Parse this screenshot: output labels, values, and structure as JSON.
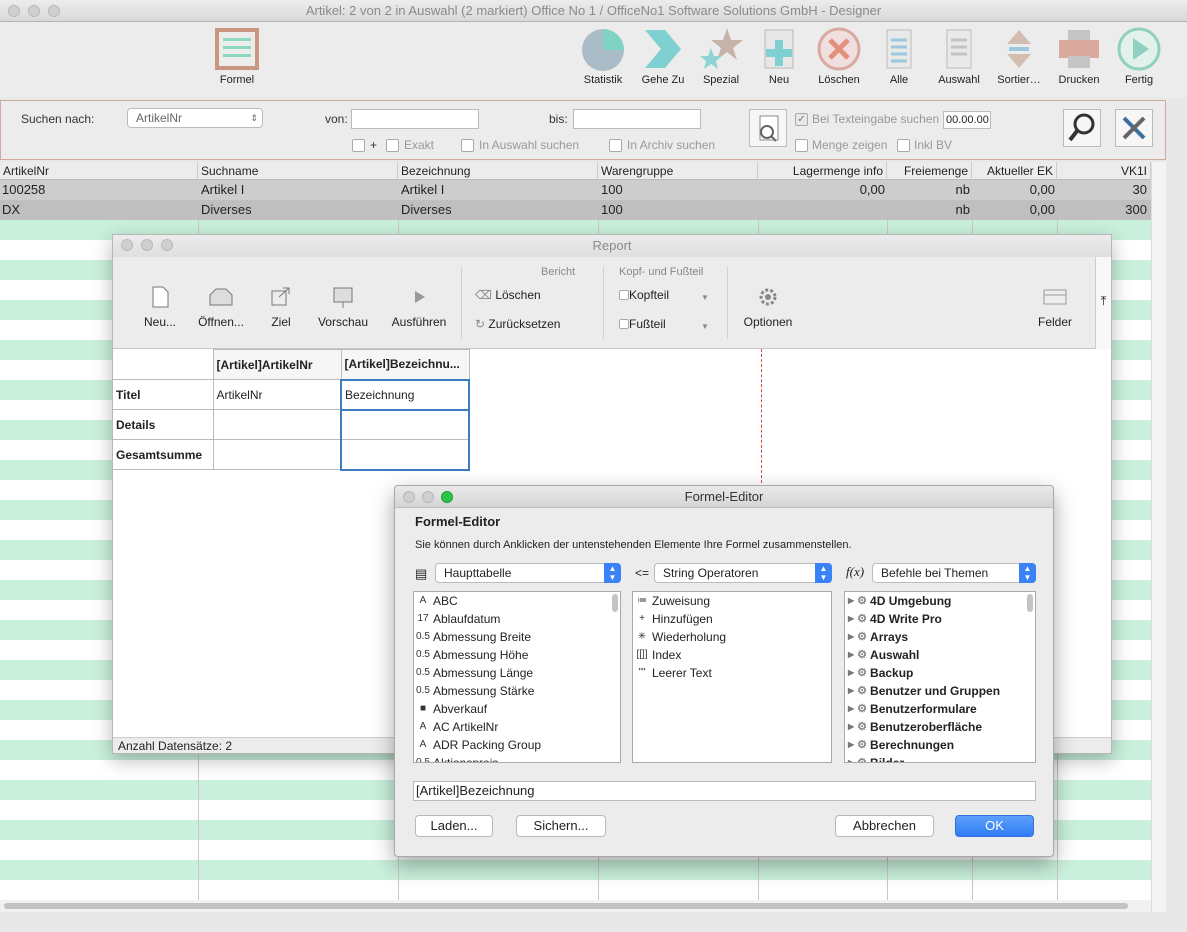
{
  "window": {
    "title": "Artikel: 2 von 2 in Auswahl  (2 markiert) Office No 1 /  OfficeNo1 Software Solutions GmbH - Designer"
  },
  "toolbar": {
    "formel": "Formel",
    "statistik": "Statistik",
    "gehe_zu": "Gehe Zu",
    "spezial": "Spezial",
    "neu": "Neu",
    "loeschen": "Löschen",
    "alle": "Alle",
    "auswahl": "Auswahl",
    "sortier": "Sortier…",
    "drucken": "Drucken",
    "fertig": "Fertig"
  },
  "search": {
    "suchen_nach_label": "Suchen nach:",
    "field_select": "ArtikelNr",
    "von_label": "von:",
    "von_value": "",
    "bis_label": "bis:",
    "bis_value": "",
    "plus": "+",
    "exakt": "Exakt",
    "in_auswahl": "In Auswahl suchen",
    "in_archiv": "In Archiv suchen",
    "bei_texteingabe": "Bei Texteingabe suchen",
    "time_value": "00.00.00",
    "menge_zeigen": "Menge zeigen",
    "inkl_bv": "Inkl BV"
  },
  "table": {
    "headers": [
      "ArtikelNr",
      "Suchname",
      "Bezeichnung",
      "Warengruppe",
      "Lagermenge info",
      "Freiemenge",
      "Aktueller EK",
      "VK1I"
    ],
    "rows": [
      [
        "100258",
        "Artikel I",
        "Artikel I",
        "100",
        "0,00",
        "nb",
        "0,00",
        "30"
      ],
      [
        "DX",
        "Diverses",
        "Diverses",
        "100",
        "",
        "nb",
        "0,00",
        "300"
      ]
    ]
  },
  "report": {
    "title": "Report",
    "section_bericht": "Bericht",
    "section_kopf": "Kopf- und Fußteil",
    "neu": "Neu...",
    "oeffnen": "Öffnen...",
    "ziel": "Ziel",
    "vorschau": "Vorschau",
    "ausfuehren": "Ausführen",
    "loeschen": "Löschen",
    "zuruecksetzen": "Zurücksetzen",
    "kopfteil": "Kopfteil",
    "fussteil": "Fußteil",
    "optionen": "Optionen",
    "felder": "Felder",
    "col1": "[Artikel]ArtikelNr",
    "col2": "[Artikel]Bezeichnu...",
    "row_titel": "Titel",
    "row_details": "Details",
    "row_gesamt": "Gesamtsumme",
    "titel_c1": "ArtikelNr",
    "titel_c2": "Bezeichnung",
    "status": "Anzahl Datensätze: 2"
  },
  "formel_editor": {
    "title": "Formel-Editor",
    "heading": "Formel-Editor",
    "description": "Sie können durch Anklicken der untenstehenden Elemente Ihre Formel zusammenstellen.",
    "table_select": "Haupttabelle",
    "assign_symbol": "<=",
    "operator_select": "String Operatoren",
    "fx": "f(x)",
    "commands_select": "Befehle bei Themen",
    "fields": [
      {
        "icon": "A",
        "label": "ABC"
      },
      {
        "icon": "17",
        "label": "Ablaufdatum"
      },
      {
        "icon": "0.5",
        "label": "Abmessung Breite"
      },
      {
        "icon": "0.5",
        "label": "Abmessung Höhe"
      },
      {
        "icon": "0.5",
        "label": "Abmessung Länge"
      },
      {
        "icon": "0.5",
        "label": "Abmessung Stärke"
      },
      {
        "icon": "■",
        "label": "Abverkauf"
      },
      {
        "icon": "A",
        "label": "AC ArtikelNr"
      },
      {
        "icon": "A",
        "label": "ADR Packing Group"
      },
      {
        "icon": "0.5",
        "label": "Aktionspreis"
      }
    ],
    "operators": [
      {
        "icon": "≔",
        "label": "Zuweisung"
      },
      {
        "icon": "+",
        "label": "Hinzufügen"
      },
      {
        "icon": "✳",
        "label": "Wiederholung"
      },
      {
        "icon": "[[]]",
        "label": "Index"
      },
      {
        "icon": "\"\"",
        "label": "Leerer Text"
      }
    ],
    "commands": [
      "4D Umgebung",
      "4D Write Pro",
      "Arrays",
      "Auswahl",
      "Backup",
      "Benutzer und Gruppen",
      "Benutzerformulare",
      "Benutzeroberfläche",
      "Berechnungen",
      "Bilder"
    ],
    "formula": "[Artikel]Bezeichnung",
    "laden": "Laden...",
    "sichern": "Sichern...",
    "abbrechen": "Abbrechen",
    "ok": "OK"
  }
}
